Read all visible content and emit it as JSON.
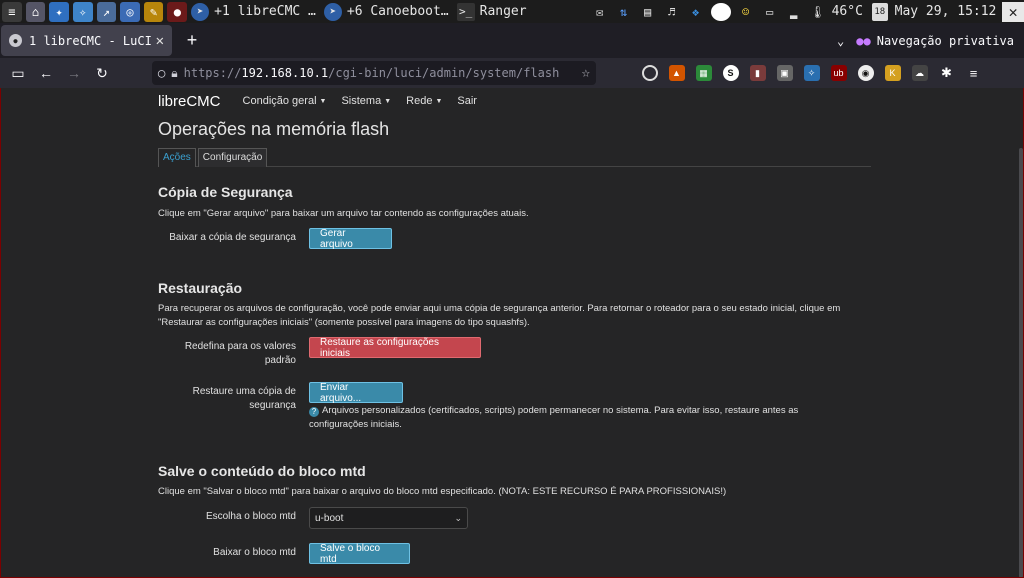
{
  "taskbar": {
    "tasks": [
      {
        "label": "+1 libreCMC …"
      },
      {
        "label": "+6 Canoeboot…"
      },
      {
        "label": "Ranger"
      }
    ],
    "temperature": "46°C",
    "calendar_day": "18",
    "clock": "May 29, 15:12"
  },
  "browser": {
    "tab_title": "1 libreCMC - LuCI",
    "private_label": "Navegação privativa",
    "url": {
      "scheme": "https://",
      "host": "192.168.10.1",
      "path": "/cgi-bin/luci/admin/system/flash"
    }
  },
  "app": {
    "brand": "libreCMC",
    "menu": [
      "Condição geral",
      "Sistema",
      "Rede",
      "Sair"
    ]
  },
  "page": {
    "title": "Operações na memória flash",
    "tabs": [
      "Ações",
      "Configuração"
    ],
    "backup": {
      "heading": "Cópia de Segurança",
      "desc": "Clique em \"Gerar arquivo\" para baixar um arquivo tar contendo as configurações atuais.",
      "label": "Baixar a cópia de segurança",
      "button": "Gerar arquivo"
    },
    "restore": {
      "heading": "Restauração",
      "desc": "Para recuperar os arquivos de configuração, você pode enviar aqui uma cópia de segurança anterior. Para retornar o roteador para o seu estado inicial, clique em \"Restaurar as configurações iniciais\" (somente possível para imagens do tipo squashfs).",
      "reset_label": "Redefina para os valores padrão",
      "reset_button": "Restaure as configurações iniciais",
      "upload_label": "Restaure uma cópia de segurança",
      "upload_button": "Enviar arquivo...",
      "hint": "Arquivos personalizados (certificados, scripts) podem permanecer no sistema. Para evitar isso, restaure antes as configurações iniciais."
    },
    "mtd": {
      "heading": "Salve o conteúdo do bloco mtd",
      "desc": "Clique em \"Salvar o bloco mtd\" para baixar o arquivo do bloco mtd especificado. (NOTA: ESTE RECURSO É PARA PROFISSIONAIS!)",
      "select_label": "Escolha o bloco mtd",
      "select_value": "u-boot",
      "save_label": "Baixar o bloco mtd",
      "save_button": "Salve o bloco mtd"
    }
  }
}
